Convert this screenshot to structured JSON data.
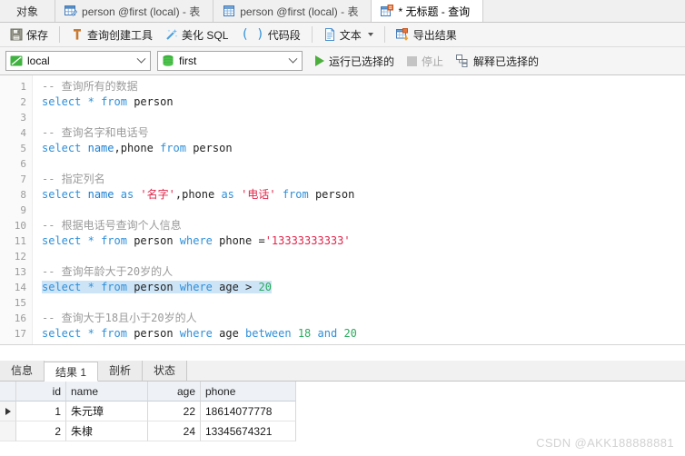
{
  "window": {
    "tabs": [
      {
        "label": "对象",
        "icon": "none",
        "active": false,
        "kind": "object"
      },
      {
        "label": "person @first (local) - 表",
        "icon": "table-edit-icon",
        "active": false,
        "kind": "table"
      },
      {
        "label": "person @first (local) - 表",
        "icon": "table-icon",
        "active": false,
        "kind": "table"
      },
      {
        "label": "* 无标题 - 查询",
        "icon": "query-icon",
        "active": true,
        "kind": "query"
      }
    ]
  },
  "toolbar": {
    "save_label": "保存",
    "query_builder_label": "查询创建工具",
    "beautify_label": "美化 SQL",
    "snippet_label": "代码段",
    "text_label": "文本",
    "export_label": "导出结果"
  },
  "connbar": {
    "connection": {
      "value": "local",
      "icon": "connection-icon"
    },
    "database": {
      "value": "first",
      "icon": "database-icon"
    },
    "run_label": "运行已选择的",
    "stop_label": "停止",
    "explain_label": "解释已选择的"
  },
  "editor": {
    "lines": [
      {
        "n": "1",
        "tokens": [
          {
            "t": "-- 查询所有的数据",
            "c": "cmt"
          }
        ]
      },
      {
        "n": "2",
        "tokens": [
          {
            "t": "select",
            "c": "kw"
          },
          {
            "t": " ",
            "c": "plain"
          },
          {
            "t": "*",
            "c": "kw"
          },
          {
            "t": " ",
            "c": "plain"
          },
          {
            "t": "from",
            "c": "kw"
          },
          {
            "t": " person",
            "c": "plain"
          }
        ]
      },
      {
        "n": "3",
        "tokens": []
      },
      {
        "n": "4",
        "tokens": [
          {
            "t": "-- 查询名字和电话号",
            "c": "cmt"
          }
        ]
      },
      {
        "n": "5",
        "tokens": [
          {
            "t": "select",
            "c": "kw"
          },
          {
            "t": " ",
            "c": "plain"
          },
          {
            "t": "name",
            "c": "kw2"
          },
          {
            "t": ",phone ",
            "c": "plain"
          },
          {
            "t": "from",
            "c": "kw"
          },
          {
            "t": " person",
            "c": "plain"
          }
        ]
      },
      {
        "n": "6",
        "tokens": []
      },
      {
        "n": "7",
        "tokens": [
          {
            "t": "-- 指定列名",
            "c": "cmt"
          }
        ]
      },
      {
        "n": "8",
        "tokens": [
          {
            "t": "select",
            "c": "kw"
          },
          {
            "t": " ",
            "c": "plain"
          },
          {
            "t": "name",
            "c": "kw2"
          },
          {
            "t": " ",
            "c": "plain"
          },
          {
            "t": "as",
            "c": "kw"
          },
          {
            "t": " ",
            "c": "plain"
          },
          {
            "t": "'名字'",
            "c": "str"
          },
          {
            "t": ",phone ",
            "c": "plain"
          },
          {
            "t": "as",
            "c": "kw"
          },
          {
            "t": " ",
            "c": "plain"
          },
          {
            "t": "'电话'",
            "c": "str"
          },
          {
            "t": " ",
            "c": "plain"
          },
          {
            "t": "from",
            "c": "kw"
          },
          {
            "t": " person",
            "c": "plain"
          }
        ]
      },
      {
        "n": "9",
        "tokens": []
      },
      {
        "n": "10",
        "tokens": [
          {
            "t": "-- 根据电话号查询个人信息",
            "c": "cmt"
          }
        ]
      },
      {
        "n": "11",
        "tokens": [
          {
            "t": "select",
            "c": "kw"
          },
          {
            "t": " ",
            "c": "plain"
          },
          {
            "t": "*",
            "c": "kw"
          },
          {
            "t": " ",
            "c": "plain"
          },
          {
            "t": "from",
            "c": "kw"
          },
          {
            "t": " person ",
            "c": "plain"
          },
          {
            "t": "where",
            "c": "kw"
          },
          {
            "t": " phone =",
            "c": "plain"
          },
          {
            "t": "'13333333333'",
            "c": "str"
          }
        ]
      },
      {
        "n": "12",
        "tokens": []
      },
      {
        "n": "13",
        "tokens": [
          {
            "t": "-- 查询年龄大于20岁的人",
            "c": "cmt"
          }
        ]
      },
      {
        "n": "14",
        "selected": true,
        "tokens": [
          {
            "t": "select",
            "c": "kw"
          },
          {
            "t": " ",
            "c": "plain"
          },
          {
            "t": "*",
            "c": "kw"
          },
          {
            "t": " ",
            "c": "plain"
          },
          {
            "t": "from",
            "c": "kw"
          },
          {
            "t": " person ",
            "c": "plain"
          },
          {
            "t": "where",
            "c": "kw"
          },
          {
            "t": " age > ",
            "c": "plain"
          },
          {
            "t": "20",
            "c": "num"
          }
        ]
      },
      {
        "n": "15",
        "tokens": []
      },
      {
        "n": "16",
        "tokens": [
          {
            "t": "-- 查询大于18且小于20岁的人",
            "c": "cmt"
          }
        ]
      },
      {
        "n": "17",
        "tokens": [
          {
            "t": "select",
            "c": "kw"
          },
          {
            "t": " ",
            "c": "plain"
          },
          {
            "t": "*",
            "c": "kw"
          },
          {
            "t": " ",
            "c": "plain"
          },
          {
            "t": "from",
            "c": "kw"
          },
          {
            "t": " person ",
            "c": "plain"
          },
          {
            "t": "where",
            "c": "kw"
          },
          {
            "t": " age ",
            "c": "plain"
          },
          {
            "t": "between",
            "c": "kw"
          },
          {
            "t": " ",
            "c": "plain"
          },
          {
            "t": "18",
            "c": "num"
          },
          {
            "t": " ",
            "c": "plain"
          },
          {
            "t": "and",
            "c": "kw"
          },
          {
            "t": " ",
            "c": "plain"
          },
          {
            "t": "20",
            "c": "num"
          }
        ]
      }
    ]
  },
  "results": {
    "tabs": [
      {
        "label": "信息",
        "active": false
      },
      {
        "label": "结果 1",
        "active": true
      },
      {
        "label": "剖析",
        "active": false
      },
      {
        "label": "状态",
        "active": false
      }
    ],
    "columns": [
      "id",
      "name",
      "age",
      "phone"
    ],
    "rows": [
      {
        "marker": true,
        "id": "1",
        "name": "朱元璋",
        "age": "22",
        "phone": "18614077778"
      },
      {
        "marker": false,
        "id": "2",
        "name": "朱棣",
        "age": "24",
        "phone": "13345674321"
      }
    ]
  },
  "watermark": {
    "text": "CSDN @AKK188888881"
  },
  "colors": {
    "accent_blue": "#2f8fd8",
    "string_red": "#e0254a",
    "number_green": "#2bab5e",
    "comment_gray": "#9a9a9a",
    "selection_blue": "#cde4f7",
    "run_green": "#4caf3d"
  }
}
